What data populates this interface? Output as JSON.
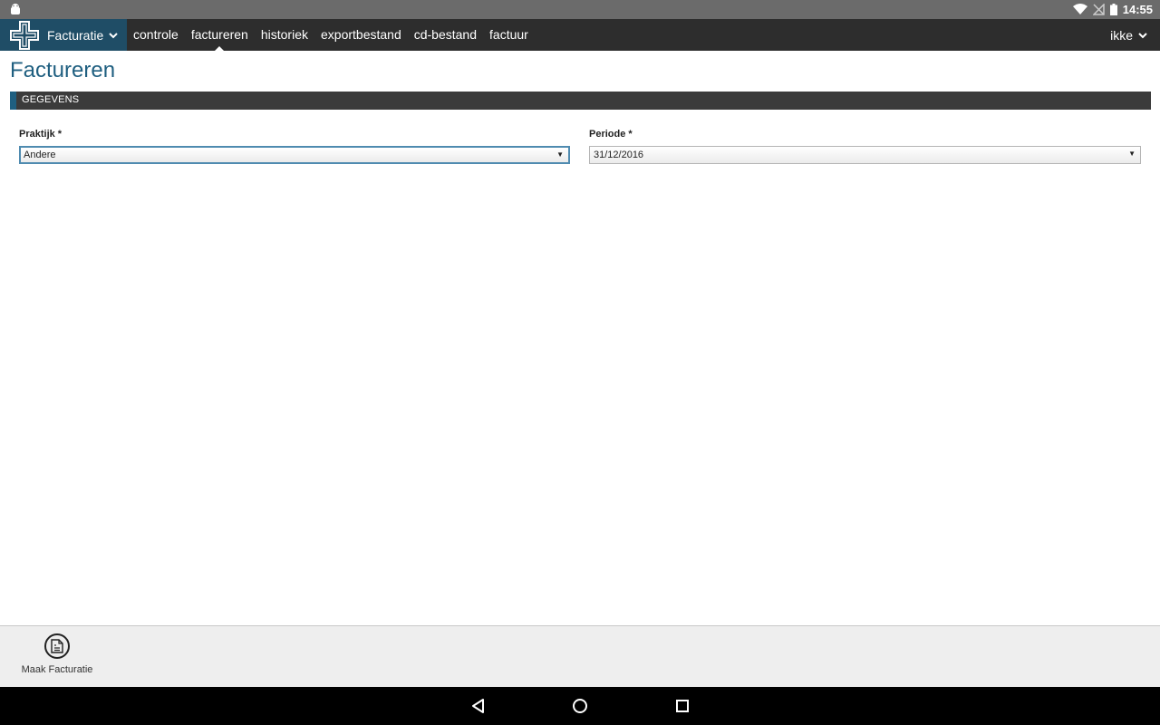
{
  "status_bar": {
    "time": "14:55"
  },
  "navbar": {
    "brand_label": "Facturatie",
    "items": [
      {
        "label": "controle"
      },
      {
        "label": "factureren"
      },
      {
        "label": "historiek"
      },
      {
        "label": "exportbestand"
      },
      {
        "label": "cd-bestand"
      },
      {
        "label": "factuur"
      }
    ],
    "active_item": "factureren",
    "user_label": "ikke"
  },
  "page": {
    "title": "Factureren",
    "section_title": "GEGEVENS",
    "fields": {
      "praktijk": {
        "label": "Praktijk *",
        "value": "Andere"
      },
      "periode": {
        "label": "Periode *",
        "value": "31/12/2016"
      }
    }
  },
  "actions": {
    "make_invoice_label": "Maak Facturatie"
  },
  "colors": {
    "brand": "#1f4d66",
    "accent": "#1f5f80",
    "navbar": "#2d2d2d",
    "section_bar": "#3b3b3b"
  }
}
